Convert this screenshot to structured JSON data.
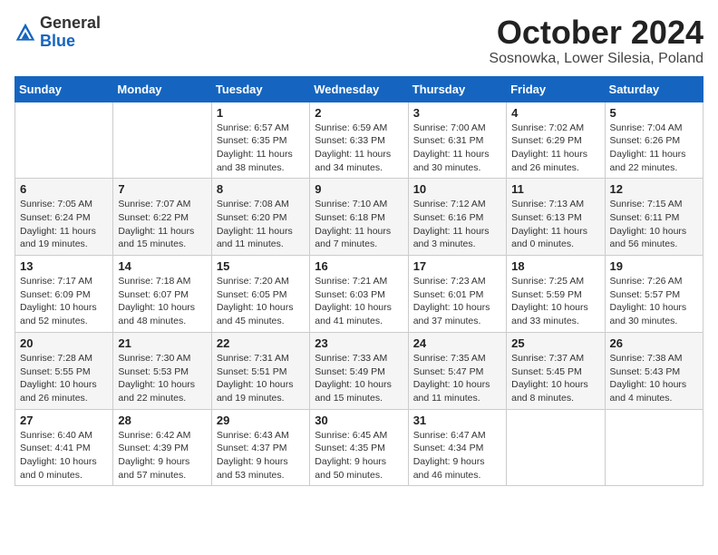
{
  "logo": {
    "general": "General",
    "blue": "Blue"
  },
  "title": "October 2024",
  "location": "Sosnowka, Lower Silesia, Poland",
  "weekdays": [
    "Sunday",
    "Monday",
    "Tuesday",
    "Wednesday",
    "Thursday",
    "Friday",
    "Saturday"
  ],
  "weeks": [
    [
      {
        "day": "",
        "info": ""
      },
      {
        "day": "",
        "info": ""
      },
      {
        "day": "1",
        "info": "Sunrise: 6:57 AM\nSunset: 6:35 PM\nDaylight: 11 hours and 38 minutes."
      },
      {
        "day": "2",
        "info": "Sunrise: 6:59 AM\nSunset: 6:33 PM\nDaylight: 11 hours and 34 minutes."
      },
      {
        "day": "3",
        "info": "Sunrise: 7:00 AM\nSunset: 6:31 PM\nDaylight: 11 hours and 30 minutes."
      },
      {
        "day": "4",
        "info": "Sunrise: 7:02 AM\nSunset: 6:29 PM\nDaylight: 11 hours and 26 minutes."
      },
      {
        "day": "5",
        "info": "Sunrise: 7:04 AM\nSunset: 6:26 PM\nDaylight: 11 hours and 22 minutes."
      }
    ],
    [
      {
        "day": "6",
        "info": "Sunrise: 7:05 AM\nSunset: 6:24 PM\nDaylight: 11 hours and 19 minutes."
      },
      {
        "day": "7",
        "info": "Sunrise: 7:07 AM\nSunset: 6:22 PM\nDaylight: 11 hours and 15 minutes."
      },
      {
        "day": "8",
        "info": "Sunrise: 7:08 AM\nSunset: 6:20 PM\nDaylight: 11 hours and 11 minutes."
      },
      {
        "day": "9",
        "info": "Sunrise: 7:10 AM\nSunset: 6:18 PM\nDaylight: 11 hours and 7 minutes."
      },
      {
        "day": "10",
        "info": "Sunrise: 7:12 AM\nSunset: 6:16 PM\nDaylight: 11 hours and 3 minutes."
      },
      {
        "day": "11",
        "info": "Sunrise: 7:13 AM\nSunset: 6:13 PM\nDaylight: 11 hours and 0 minutes."
      },
      {
        "day": "12",
        "info": "Sunrise: 7:15 AM\nSunset: 6:11 PM\nDaylight: 10 hours and 56 minutes."
      }
    ],
    [
      {
        "day": "13",
        "info": "Sunrise: 7:17 AM\nSunset: 6:09 PM\nDaylight: 10 hours and 52 minutes."
      },
      {
        "day": "14",
        "info": "Sunrise: 7:18 AM\nSunset: 6:07 PM\nDaylight: 10 hours and 48 minutes."
      },
      {
        "day": "15",
        "info": "Sunrise: 7:20 AM\nSunset: 6:05 PM\nDaylight: 10 hours and 45 minutes."
      },
      {
        "day": "16",
        "info": "Sunrise: 7:21 AM\nSunset: 6:03 PM\nDaylight: 10 hours and 41 minutes."
      },
      {
        "day": "17",
        "info": "Sunrise: 7:23 AM\nSunset: 6:01 PM\nDaylight: 10 hours and 37 minutes."
      },
      {
        "day": "18",
        "info": "Sunrise: 7:25 AM\nSunset: 5:59 PM\nDaylight: 10 hours and 33 minutes."
      },
      {
        "day": "19",
        "info": "Sunrise: 7:26 AM\nSunset: 5:57 PM\nDaylight: 10 hours and 30 minutes."
      }
    ],
    [
      {
        "day": "20",
        "info": "Sunrise: 7:28 AM\nSunset: 5:55 PM\nDaylight: 10 hours and 26 minutes."
      },
      {
        "day": "21",
        "info": "Sunrise: 7:30 AM\nSunset: 5:53 PM\nDaylight: 10 hours and 22 minutes."
      },
      {
        "day": "22",
        "info": "Sunrise: 7:31 AM\nSunset: 5:51 PM\nDaylight: 10 hours and 19 minutes."
      },
      {
        "day": "23",
        "info": "Sunrise: 7:33 AM\nSunset: 5:49 PM\nDaylight: 10 hours and 15 minutes."
      },
      {
        "day": "24",
        "info": "Sunrise: 7:35 AM\nSunset: 5:47 PM\nDaylight: 10 hours and 11 minutes."
      },
      {
        "day": "25",
        "info": "Sunrise: 7:37 AM\nSunset: 5:45 PM\nDaylight: 10 hours and 8 minutes."
      },
      {
        "day": "26",
        "info": "Sunrise: 7:38 AM\nSunset: 5:43 PM\nDaylight: 10 hours and 4 minutes."
      }
    ],
    [
      {
        "day": "27",
        "info": "Sunrise: 6:40 AM\nSunset: 4:41 PM\nDaylight: 10 hours and 0 minutes."
      },
      {
        "day": "28",
        "info": "Sunrise: 6:42 AM\nSunset: 4:39 PM\nDaylight: 9 hours and 57 minutes."
      },
      {
        "day": "29",
        "info": "Sunrise: 6:43 AM\nSunset: 4:37 PM\nDaylight: 9 hours and 53 minutes."
      },
      {
        "day": "30",
        "info": "Sunrise: 6:45 AM\nSunset: 4:35 PM\nDaylight: 9 hours and 50 minutes."
      },
      {
        "day": "31",
        "info": "Sunrise: 6:47 AM\nSunset: 4:34 PM\nDaylight: 9 hours and 46 minutes."
      },
      {
        "day": "",
        "info": ""
      },
      {
        "day": "",
        "info": ""
      }
    ]
  ]
}
